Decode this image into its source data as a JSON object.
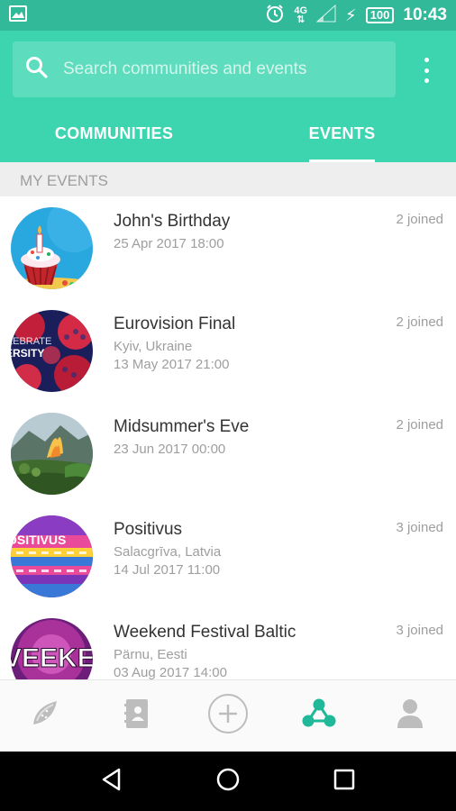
{
  "status_bar": {
    "network": "4G",
    "battery": "100",
    "time": "10:43"
  },
  "search": {
    "placeholder": "Search communities and events"
  },
  "tabs": [
    {
      "label": "COMMUNITIES",
      "active": false
    },
    {
      "label": "EVENTS",
      "active": true
    }
  ],
  "section": {
    "title": "MY EVENTS"
  },
  "events": [
    {
      "title": "John's Birthday",
      "line1": "25 Apr 2017 18:00",
      "line2": "",
      "joined": "2 joined",
      "image": "birthday-cupcake"
    },
    {
      "title": "Eurovision Final",
      "line1": "Kyiv, Ukraine",
      "line2": "13 May 2017 21:00",
      "joined": "2 joined",
      "image": "eurovision-logo"
    },
    {
      "title": "Midsummer's Eve",
      "line1": "23 Jun 2017 00:00",
      "line2": "",
      "joined": "2 joined",
      "image": "midsummer-landscape"
    },
    {
      "title": "Positivus",
      "line1": "Salacgrīva, Latvia",
      "line2": "14 Jul 2017 11:00",
      "joined": "3 joined",
      "image": "positivus-poster"
    },
    {
      "title": "Weekend Festival Baltic",
      "line1": "Pärnu, Eesti",
      "line2": "03 Aug 2017 14:00",
      "joined": "3 joined",
      "image": "weekend-festival-poster"
    }
  ],
  "avatar_text": {
    "eurovision": "CELEBRATE DIVERSITY",
    "positivus": "POSITIVUS",
    "weekend": "WEEKEND"
  },
  "bottom_nav": [
    {
      "icon": "watermelon-icon",
      "active": false
    },
    {
      "icon": "contacts-book-icon",
      "active": false
    },
    {
      "icon": "add-circle-icon",
      "active": false
    },
    {
      "icon": "community-network-icon",
      "active": true
    },
    {
      "icon": "profile-icon",
      "active": false
    }
  ],
  "colors": {
    "primary": "#3dd4b0",
    "primary_dark": "#32b99a",
    "active_nav": "#1fb898",
    "inactive_nav": "#bdbdbd"
  }
}
